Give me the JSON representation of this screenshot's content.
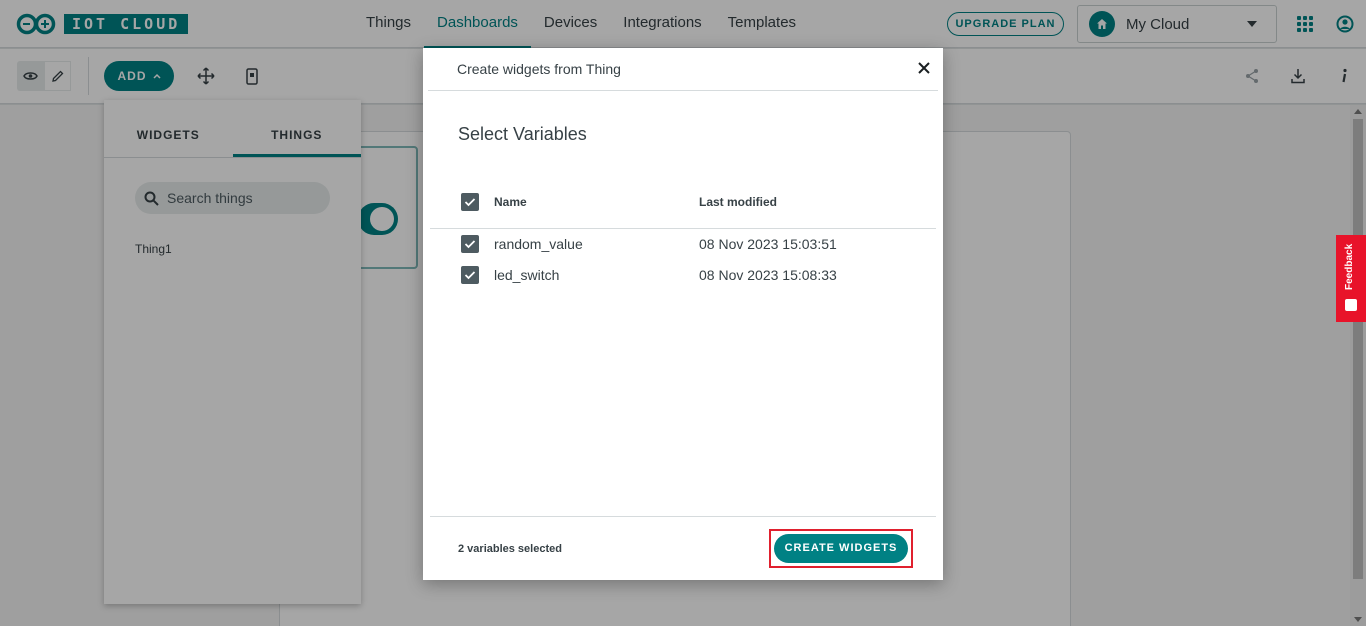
{
  "header": {
    "logo_text": "IOT CLOUD",
    "nav": [
      {
        "label": "Things",
        "active": false
      },
      {
        "label": "Dashboards",
        "active": true
      },
      {
        "label": "Devices",
        "active": false
      },
      {
        "label": "Integrations",
        "active": false
      },
      {
        "label": "Templates",
        "active": false
      }
    ],
    "upgrade_label": "UPGRADE PLAN",
    "space_name": "My Cloud"
  },
  "toolbar": {
    "add_label": "ADD"
  },
  "side_panel": {
    "tabs": [
      {
        "label": "WIDGETS",
        "active": false
      },
      {
        "label": "THINGS",
        "active": true
      }
    ],
    "search_placeholder": "Search things",
    "things": [
      "Thing1"
    ]
  },
  "feedback_label": "Feedback",
  "modal": {
    "title": "Create widgets from Thing",
    "subtitle": "Select Variables",
    "columns": {
      "name": "Name",
      "last_modified": "Last modified"
    },
    "rows": [
      {
        "name": "random_value",
        "last_modified": "08 Nov 2023 15:03:51",
        "checked": true
      },
      {
        "name": "led_switch",
        "last_modified": "08 Nov 2023 15:08:33",
        "checked": true
      }
    ],
    "selected_count": "2 variables selected",
    "create_label": "CREATE WIDGETS"
  },
  "colors": {
    "brand": "#008184",
    "highlight": "#e0202e",
    "feedback": "#e8132a"
  }
}
